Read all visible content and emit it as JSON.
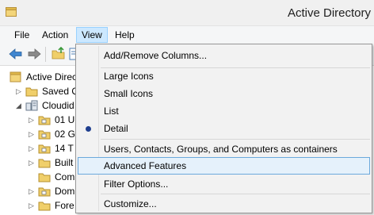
{
  "window": {
    "title": "Active Directory"
  },
  "menu": {
    "items": [
      {
        "label": "File"
      },
      {
        "label": "Action"
      },
      {
        "label": "View"
      },
      {
        "label": "Help"
      }
    ]
  },
  "tree": {
    "items": [
      {
        "label": "Active Direct",
        "expander": ""
      },
      {
        "label": "Saved Q",
        "expander": "▷"
      },
      {
        "label": "Cloudid",
        "expander": "◢"
      },
      {
        "label": "01 U",
        "expander": "▷"
      },
      {
        "label": "02 G",
        "expander": "▷"
      },
      {
        "label": "14 T",
        "expander": "▷"
      },
      {
        "label": "Built",
        "expander": "▷"
      },
      {
        "label": "Com",
        "expander": ""
      },
      {
        "label": "Dom",
        "expander": "▷"
      },
      {
        "label": "Fore",
        "expander": "▷"
      }
    ]
  },
  "view_menu": {
    "items": [
      {
        "label": "Add/Remove Columns..."
      },
      {
        "label": "Large Icons"
      },
      {
        "label": "Small Icons"
      },
      {
        "label": "List"
      },
      {
        "label": "Detail"
      },
      {
        "label": "Users, Contacts, Groups, and Computers as containers"
      },
      {
        "label": "Advanced Features"
      },
      {
        "label": "Filter Options..."
      },
      {
        "label": "Customize..."
      }
    ],
    "selected_view": "Detail",
    "hovered": "Advanced Features"
  },
  "colors": {
    "menu_active": "#cce8ff",
    "hover_border": "#6ca9dc",
    "hover_fill": "#e5f1fb",
    "folder": "#e8c25a",
    "bullet": "#1f3f8f"
  }
}
